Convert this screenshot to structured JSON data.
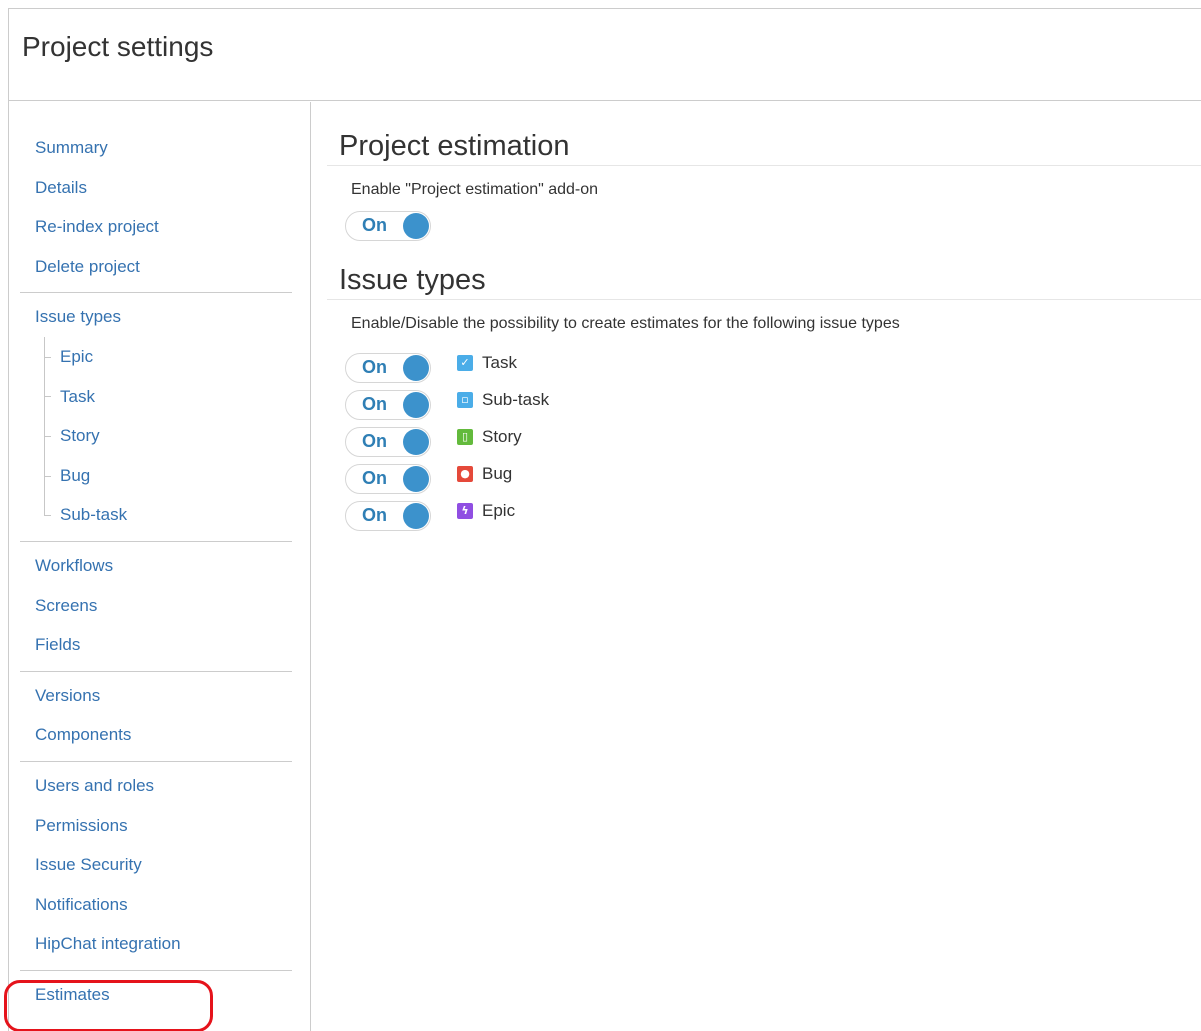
{
  "header": {
    "title": "Project settings"
  },
  "sidebar": {
    "groups": [
      {
        "items": [
          {
            "label": "Summary"
          },
          {
            "label": "Details"
          },
          {
            "label": "Re-index project"
          },
          {
            "label": "Delete project"
          }
        ]
      },
      {
        "items": [
          {
            "label": "Issue types"
          },
          {
            "label": "Epic"
          },
          {
            "label": "Task"
          },
          {
            "label": "Story"
          },
          {
            "label": "Bug"
          },
          {
            "label": "Sub-task"
          }
        ]
      },
      {
        "items": [
          {
            "label": "Workflows"
          },
          {
            "label": "Screens"
          },
          {
            "label": "Fields"
          }
        ]
      },
      {
        "items": [
          {
            "label": "Versions"
          },
          {
            "label": "Components"
          }
        ]
      },
      {
        "items": [
          {
            "label": "Users and roles"
          },
          {
            "label": "Permissions"
          },
          {
            "label": "Issue Security"
          },
          {
            "label": "Notifications"
          },
          {
            "label": "HipChat integration"
          }
        ]
      },
      {
        "items": [
          {
            "label": "Estimates"
          }
        ]
      }
    ]
  },
  "main": {
    "estimation": {
      "title": "Project estimation",
      "description": "Enable \"Project estimation\" add-on",
      "toggle": {
        "label": "On",
        "state": "on"
      }
    },
    "issue_types": {
      "title": "Issue types",
      "description": "Enable/Disable the possibility to create estimates for the following issue types",
      "rows": [
        {
          "toggle": "On",
          "name": "Task",
          "icon": "task-icon",
          "color": "#4bade8",
          "glyph": "✓"
        },
        {
          "toggle": "On",
          "name": "Sub-task",
          "icon": "subtask-icon",
          "color": "#4bade8",
          "glyph": "▫"
        },
        {
          "toggle": "On",
          "name": "Story",
          "icon": "story-icon",
          "color": "#63ba3c",
          "glyph": "▯"
        },
        {
          "toggle": "On",
          "name": "Bug",
          "icon": "bug-icon",
          "color": "#e5493a",
          "glyph": "●"
        },
        {
          "toggle": "On",
          "name": "Epic",
          "icon": "epic-icon",
          "color": "#904ee2",
          "glyph": "ϟ"
        }
      ]
    }
  },
  "colors": {
    "link": "#3572b0",
    "toggle_knob": "#3c92cc",
    "highlight": "#e5131b"
  }
}
